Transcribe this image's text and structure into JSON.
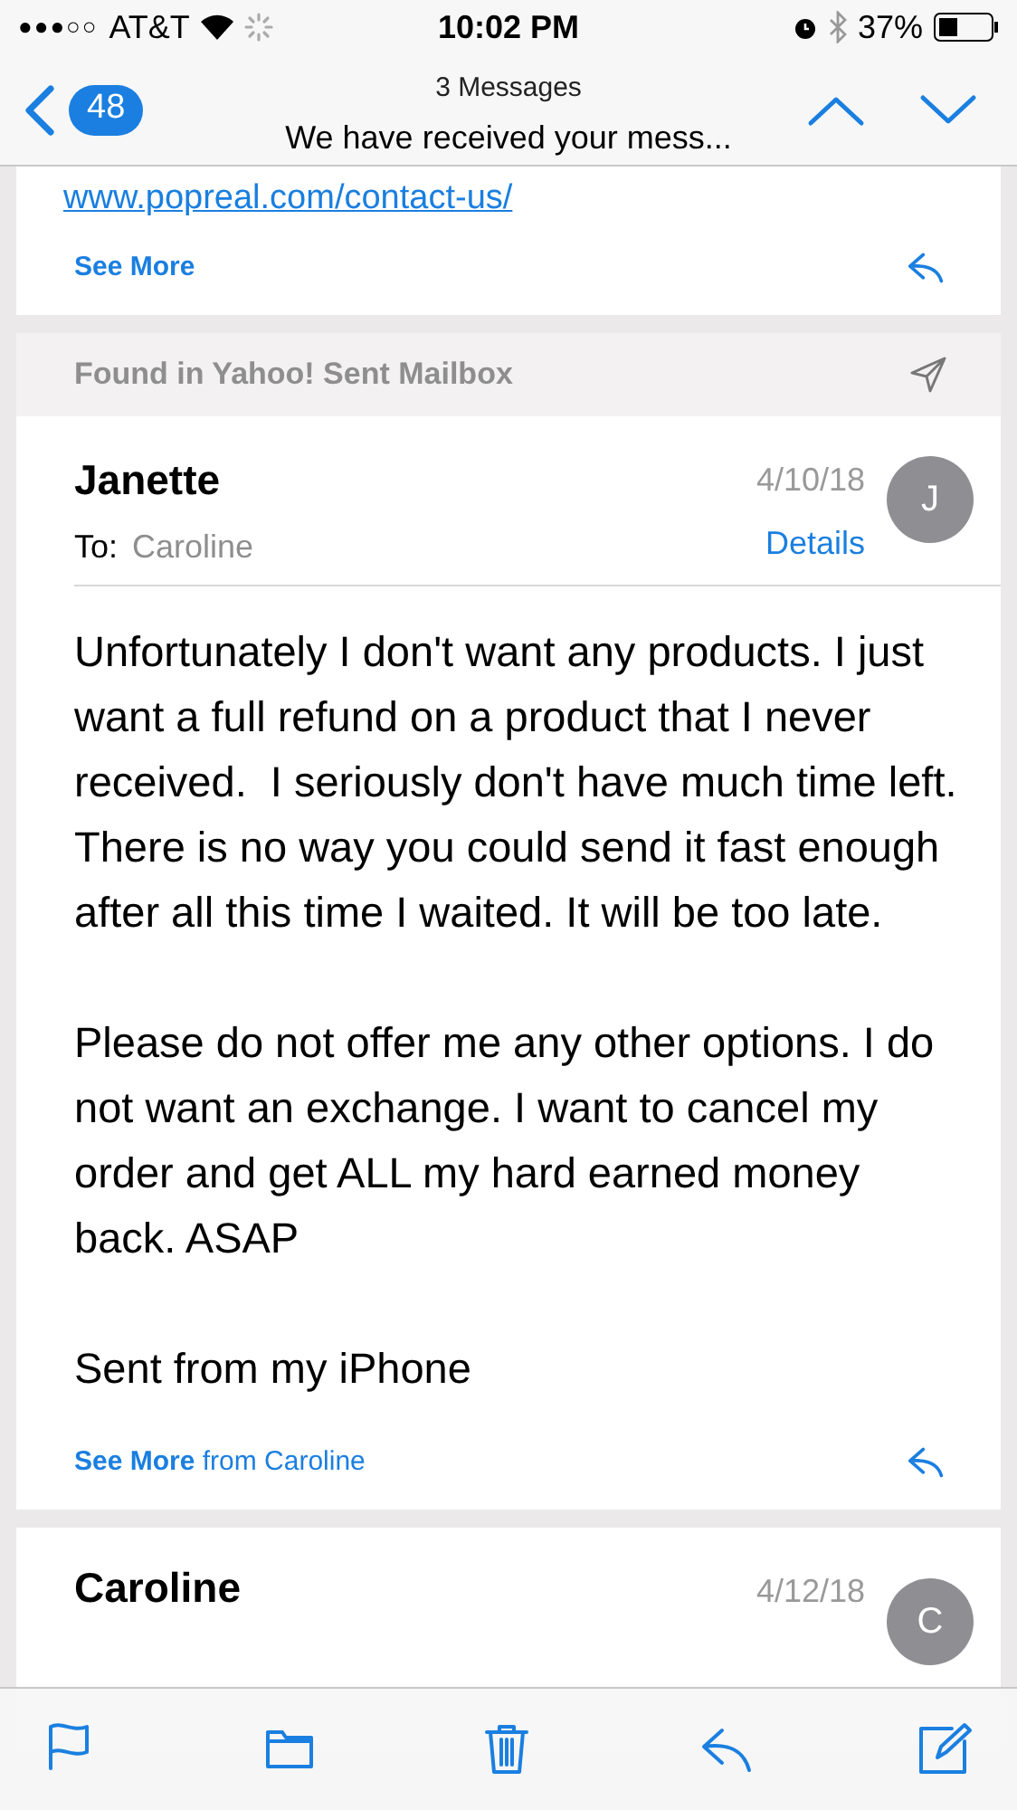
{
  "status_bar": {
    "signal": "●●●○○",
    "carrier": "AT&T",
    "time": "10:02 PM",
    "battery": "37%"
  },
  "nav": {
    "back_count": "48",
    "subtitle": "3 Messages",
    "title": "We have received your mess..."
  },
  "messages": [
    {
      "kind": "tail",
      "link": "www.popreal.com/contact-us/",
      "see_more": "See More"
    },
    {
      "kind": "full",
      "found_in": "Found in Yahoo! Sent Mailbox",
      "sender": "Janette",
      "to_label": "To:",
      "to": "Caroline",
      "date": "4/10/18",
      "details": "Details",
      "initial": "J",
      "paragraphs": [
        "Unfortunately I don't want any products. I just want a full refund on a product that I never received.  I seriously don't have much time left. There is no way you could send it fast enough after all this time I waited. It will be too late.",
        "Please do not offer me any other options. I do not want an exchange. I want to cancel my order and get ALL my hard earned money back. ASAP",
        "Sent from my iPhone"
      ],
      "see_more": "See More",
      "see_more_from": "from Caroline"
    },
    {
      "kind": "head",
      "sender": "Caroline",
      "date": "4/12/18",
      "initial": "C"
    }
  ]
}
